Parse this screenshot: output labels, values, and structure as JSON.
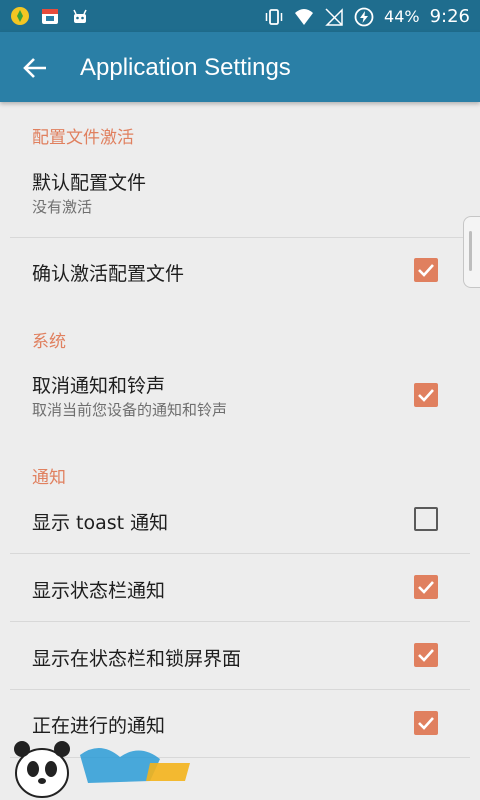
{
  "statusbar": {
    "icons_left": [
      "app-icon-1",
      "calendar-icon",
      "android-icon"
    ],
    "icons_right": [
      "vibrate-icon",
      "wifi-icon",
      "no-signal-icon",
      "battery-icon"
    ],
    "battery": "44%",
    "time": "9:26"
  },
  "toolbar": {
    "title": "Application Settings"
  },
  "sections": {
    "profile": {
      "header": "配置文件激活",
      "default_profile": {
        "title": "默认配置文件",
        "subtitle": "没有激活"
      },
      "confirm_activation": {
        "title": "确认激活配置文件",
        "checked": true
      }
    },
    "system": {
      "header": "系统",
      "cancel_notifications": {
        "title": "取消通知和铃声",
        "subtitle": "取消当前您设备的通知和铃声",
        "checked": true
      }
    },
    "notifications": {
      "header": "通知",
      "show_toast": {
        "title": "显示 toast 通知",
        "checked": false
      },
      "show_statusbar": {
        "title": "显示状态栏通知",
        "checked": true
      },
      "show_statusbar_lockscreen": {
        "title": "显示在状态栏和锁屏界面",
        "checked": true
      },
      "ongoing": {
        "title": "正在进行的通知",
        "checked": true
      }
    }
  },
  "colors": {
    "toolbar": "#2a7fa6",
    "statusbar": "#1f6d8e",
    "accent": "#e0805f"
  }
}
